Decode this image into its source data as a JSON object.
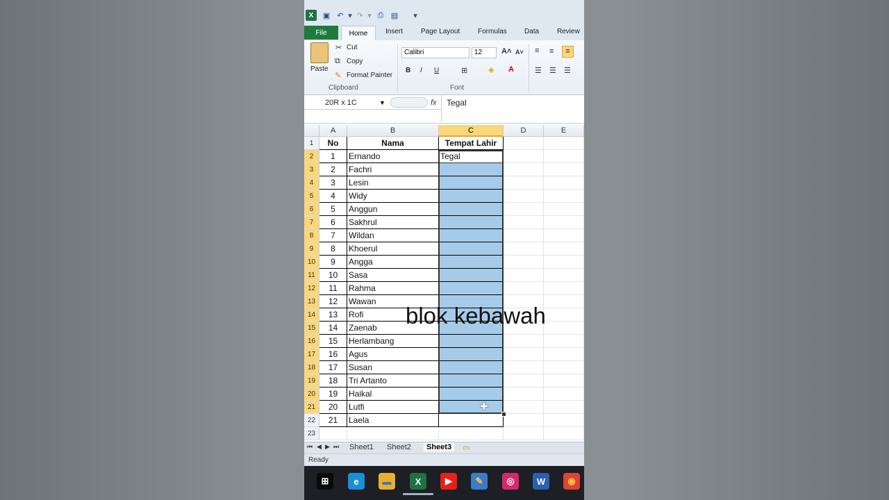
{
  "ribbon": {
    "tabs": [
      "File",
      "Home",
      "Insert",
      "Page Layout",
      "Formulas",
      "Data",
      "Review"
    ],
    "clipboard": {
      "paste": "Paste",
      "cut": "Cut",
      "copy": "Copy",
      "format_painter": "Format Painter",
      "label": "Clipboard"
    },
    "font": {
      "name": "Calibri",
      "size": "12",
      "bold": "B",
      "italic": "I",
      "underline": "U",
      "label": "Font"
    }
  },
  "formula_bar": {
    "name_box": "20R x 1C",
    "fx": "fx",
    "value": "Tegal"
  },
  "grid": {
    "columns": [
      "A",
      "B",
      "C",
      "D",
      "E"
    ],
    "headers": {
      "no": "No",
      "nama": "Nama",
      "tempat": "Tempat Lahir"
    },
    "rows": [
      {
        "no": "1",
        "nama": "Ernando",
        "tempat": "Tegal"
      },
      {
        "no": "2",
        "nama": "Fachri"
      },
      {
        "no": "3",
        "nama": "Lesin"
      },
      {
        "no": "4",
        "nama": "Widy"
      },
      {
        "no": "5",
        "nama": "Anggun"
      },
      {
        "no": "6",
        "nama": "Sakhrul"
      },
      {
        "no": "7",
        "nama": "Wildan"
      },
      {
        "no": "8",
        "nama": "Khoerul"
      },
      {
        "no": "9",
        "nama": "Angga"
      },
      {
        "no": "10",
        "nama": "Sasa"
      },
      {
        "no": "11",
        "nama": "Rahma"
      },
      {
        "no": "12",
        "nama": "Wawan"
      },
      {
        "no": "13",
        "nama": "Rofi"
      },
      {
        "no": "14",
        "nama": "Zaenab"
      },
      {
        "no": "15",
        "nama": "Herlambang"
      },
      {
        "no": "16",
        "nama": "Agus"
      },
      {
        "no": "17",
        "nama": "Susan"
      },
      {
        "no": "18",
        "nama": "Tri Artanto"
      },
      {
        "no": "19",
        "nama": "Haikal"
      },
      {
        "no": "20",
        "nama": "Lutfi"
      },
      {
        "no": "21",
        "nama": "Laela"
      }
    ],
    "row_numbers": [
      "1",
      "2",
      "3",
      "4",
      "5",
      "6",
      "7",
      "8",
      "9",
      "10",
      "11",
      "12",
      "13",
      "14",
      "15",
      "16",
      "17",
      "18",
      "19",
      "20",
      "21",
      "22",
      "23"
    ],
    "selection_color": "#a6cbe9"
  },
  "sheets": {
    "tabs": [
      "Sheet1",
      "Sheet2",
      "Sheet3"
    ],
    "active": "Sheet3"
  },
  "status": "Ready",
  "overlay_caption": "blok kebawah",
  "taskbar_icons": [
    "windows-icon",
    "edge-icon",
    "file-explorer-icon",
    "excel-icon",
    "youtube-icon",
    "paint-icon",
    "instagram-icon",
    "word-icon",
    "chrome-icon"
  ]
}
